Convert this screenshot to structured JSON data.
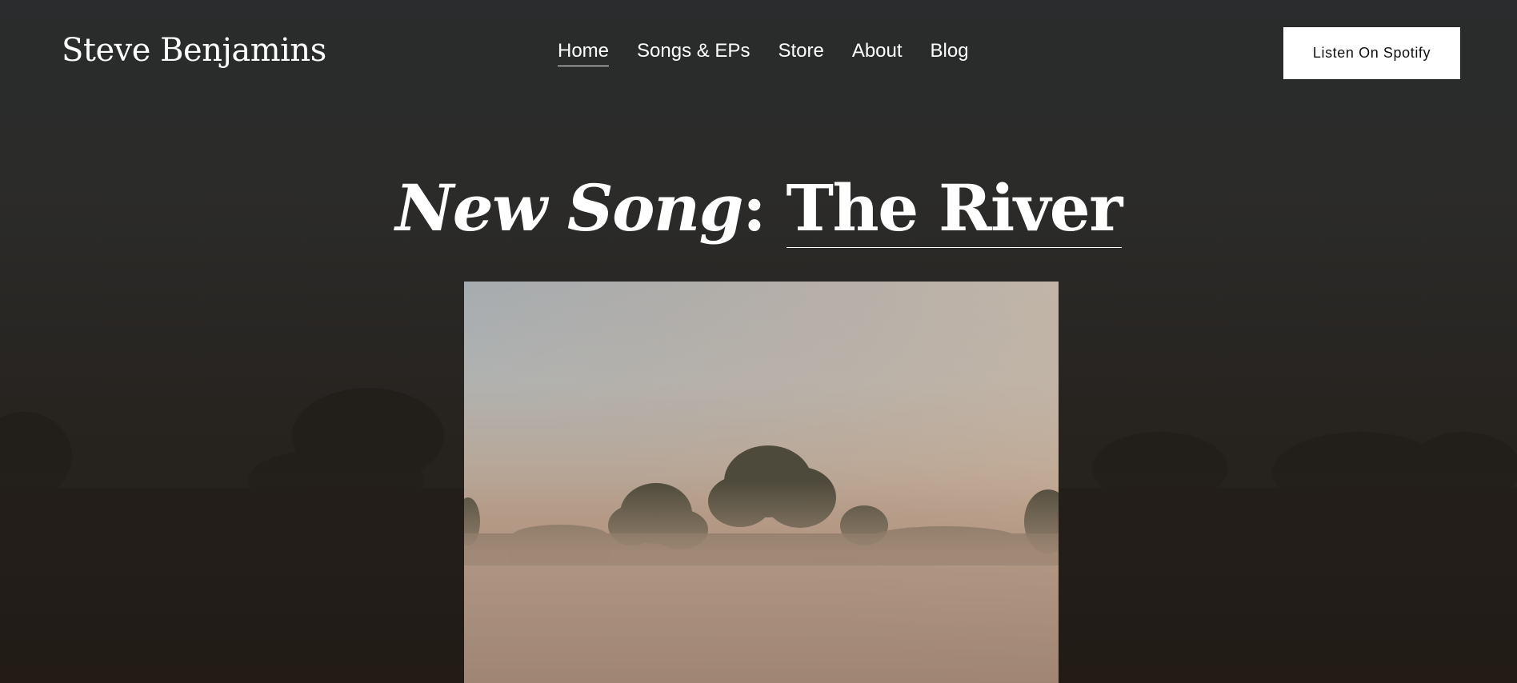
{
  "site": {
    "title": "Steve Benjamins"
  },
  "nav": {
    "items": [
      {
        "label": "Home",
        "active": true
      },
      {
        "label": "Songs & EPs",
        "active": false
      },
      {
        "label": "Store",
        "active": false
      },
      {
        "label": "About",
        "active": false
      },
      {
        "label": "Blog",
        "active": false
      }
    ]
  },
  "cta": {
    "label": "Listen On Spotify"
  },
  "hero": {
    "prefix": "New Song",
    "separator": ": ",
    "song_title": "The River"
  },
  "colors": {
    "background": "#2a2b2b",
    "button_bg": "#ffffff",
    "button_text": "#111111",
    "text": "#ffffff"
  }
}
